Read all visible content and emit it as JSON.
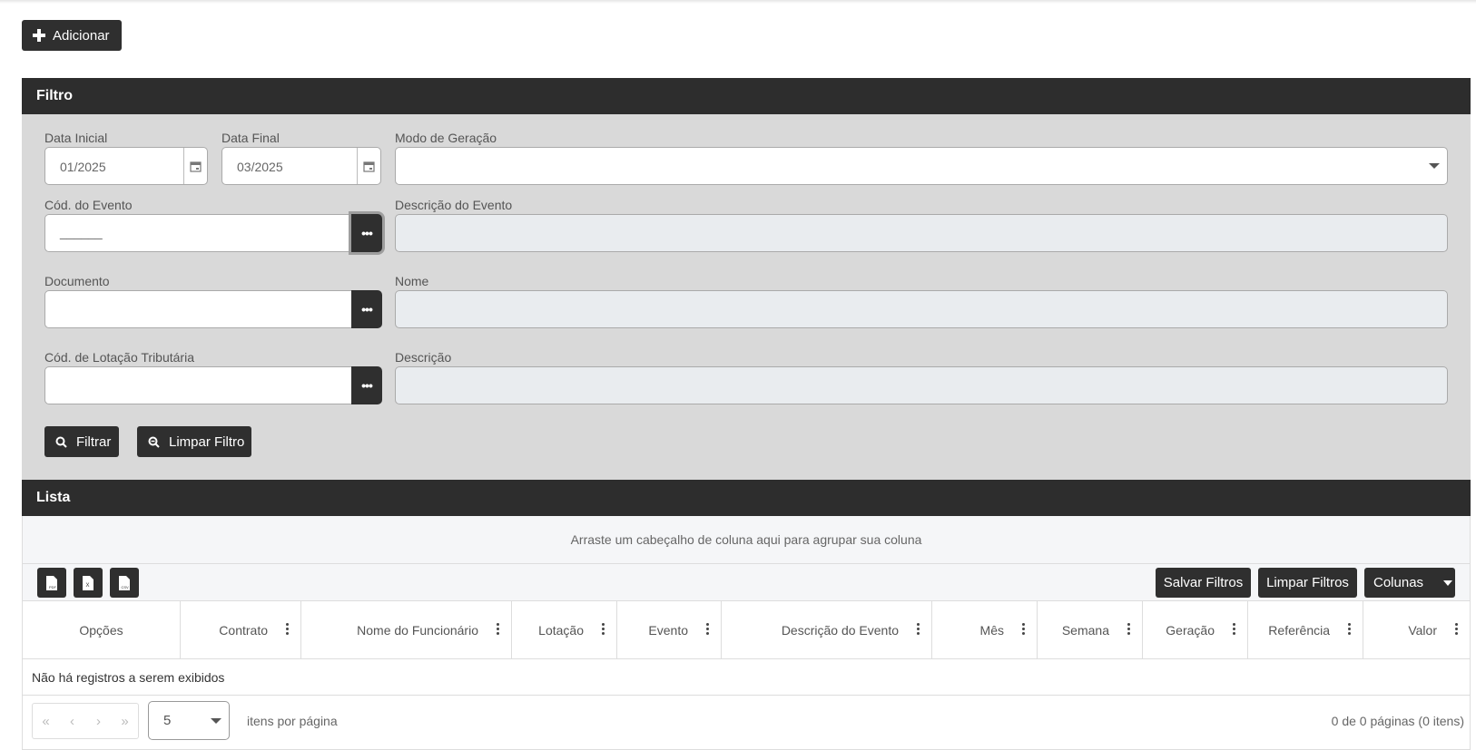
{
  "toolbar": {
    "add_label": "Adicionar"
  },
  "filter": {
    "title": "Filtro",
    "data_inicial": {
      "label": "Data Inicial",
      "value": "01/2025"
    },
    "data_final": {
      "label": "Data Final",
      "value": "03/2025"
    },
    "modo_geracao": {
      "label": "Modo de Geração",
      "value": ""
    },
    "cod_evento": {
      "label": "Cód. do Evento",
      "value": "______"
    },
    "descricao_evento": {
      "label": "Descrição do Evento",
      "value": ""
    },
    "documento": {
      "label": "Documento",
      "value": ""
    },
    "nome": {
      "label": "Nome",
      "value": ""
    },
    "cod_lotacao": {
      "label": "Cód. de Lotação Tributária",
      "value": ""
    },
    "descricao": {
      "label": "Descrição",
      "value": ""
    },
    "filtrar_label": "Filtrar",
    "limpar_label": "Limpar Filtro"
  },
  "list": {
    "title": "Lista",
    "group_hint": "Arraste um cabeçalho de coluna aqui para agrupar sua coluna",
    "export_icons": [
      "pdf-icon",
      "excel-icon",
      "csv-icon"
    ],
    "salvar_filtros": "Salvar Filtros",
    "limpar_filtros": "Limpar Filtros",
    "colunas": "Colunas",
    "columns": [
      "Opções",
      "Contrato",
      "Nome do Funcionário",
      "Lotação",
      "Evento",
      "Descrição do Evento",
      "Mês",
      "Semana",
      "Geração",
      "Referência",
      "Valor"
    ],
    "empty_message": "Não há registros a serem exibidos",
    "page_size": "5",
    "per_page_label": "itens por página",
    "page_info": "0 de 0 páginas (0 itens)"
  },
  "colors": {
    "dark": "#2d2d2d",
    "filter_bg": "#d9d9d9",
    "readonly_bg": "#e9ecef"
  }
}
